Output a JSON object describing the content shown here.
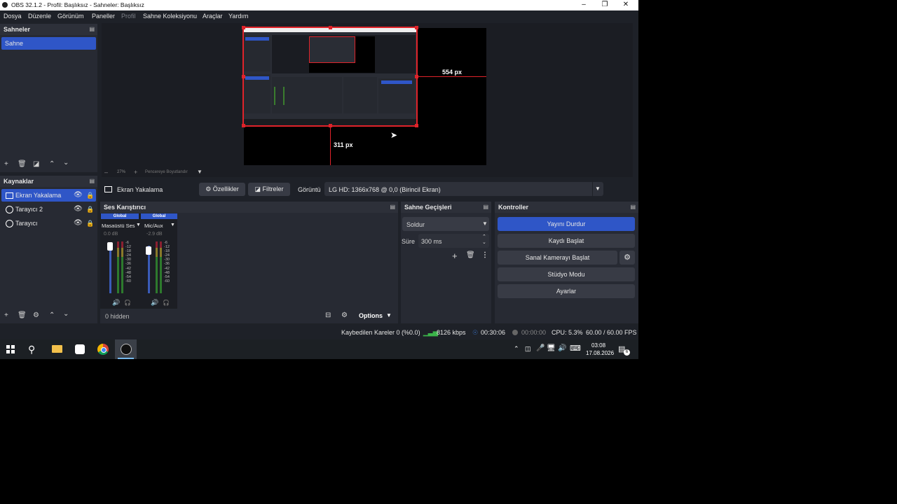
{
  "window": {
    "title": "OBS 32.1.2 - Profil: Başlıksız - Sahneler: Başlıksız"
  },
  "menu": [
    "Dosya",
    "Düzenle",
    "Görünüm",
    "Paneller",
    "Profil",
    "Sahne Koleksiyonu",
    "Araçlar",
    "Yardım"
  ],
  "preview": {
    "width_label": "554 px",
    "height_label": "311 px",
    "zoom": "27%",
    "zoom_mode": "Pencereye Boyutlandır"
  },
  "scenes": {
    "title": "Sahneler",
    "items": [
      "Sahne"
    ]
  },
  "sources": {
    "title": "Kaynaklar",
    "items": [
      "Ekran Yakalama",
      "Tarayıcı 2",
      "Tarayıcı"
    ]
  },
  "props": {
    "source": "Ekran Yakalama",
    "properties": "Özellikler",
    "filters": "Filtreler",
    "display_label": "Görüntü",
    "display_value": "LG HD: 1366x768 @ 0,0 (Birincil Ekran)"
  },
  "mixer": {
    "title": "Ses Karıştırıcı",
    "channels": [
      {
        "tag": "Global",
        "name": "Masaüstü Ses",
        "db": "0.0 dB"
      },
      {
        "tag": "Global",
        "name": "Mic/Aux",
        "db": "-2.9 dB"
      }
    ],
    "scale": [
      "-6",
      "-12",
      "-18",
      "-24",
      "-30",
      "-36",
      "-42",
      "-48",
      "-54",
      "-60"
    ],
    "hidden": "0 hidden",
    "options": "Options"
  },
  "transitions": {
    "title": "Sahne Geçişleri",
    "type": "Soldur",
    "duration_label": "Süre",
    "duration": "300 ms"
  },
  "controls": {
    "title": "Kontroller",
    "stop_stream": "Yayını Durdur",
    "start_record": "Kaydı Başlat",
    "virtual_cam": "Sanal Kamerayı Başlat",
    "studio": "Stüdyo Modu",
    "settings": "Ayarlar"
  },
  "status": {
    "dropped": "Kaybedilen Kareler 0 (%0.0)",
    "bitrate": "8126 kbps",
    "stream_time": "00:30:06",
    "rec_time": "00:00:00",
    "cpu": "CPU: 5.3%",
    "fps": "60.00 / 60.00 FPS"
  },
  "taskbar": {
    "time": "03:08",
    "date": "17.08.2026",
    "notif": "6"
  },
  "colors": {
    "accent": "#2f56c7",
    "selection_red": "#e0232a"
  }
}
